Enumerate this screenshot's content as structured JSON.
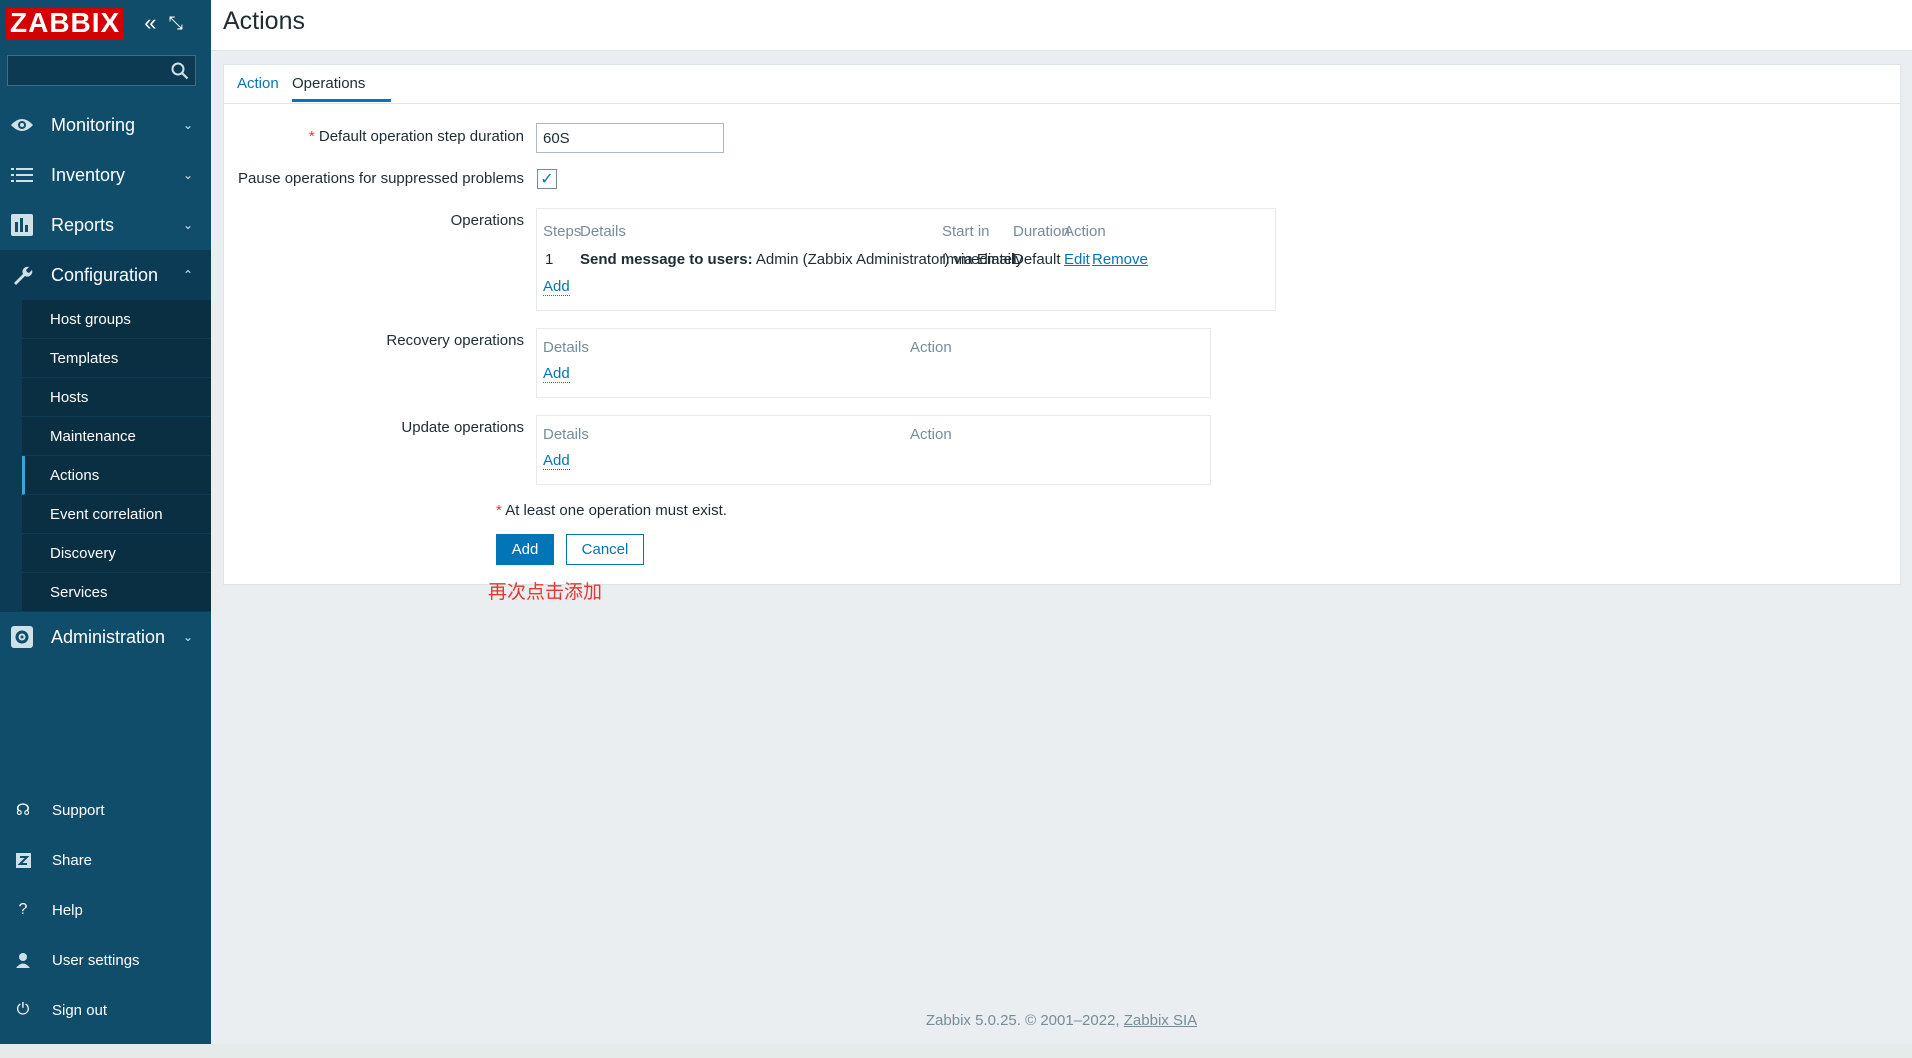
{
  "logo": "ZABBIX",
  "sidebar": {
    "search_placeholder": "",
    "nav": [
      {
        "label": "Monitoring",
        "icon": "eye-icon"
      },
      {
        "label": "Inventory",
        "icon": "list-icon"
      },
      {
        "label": "Reports",
        "icon": "bar-chart-icon"
      },
      {
        "label": "Configuration",
        "icon": "wrench-icon"
      }
    ],
    "config_items": [
      "Host groups",
      "Templates",
      "Hosts",
      "Maintenance",
      "Actions",
      "Event correlation",
      "Discovery",
      "Services"
    ],
    "admin": {
      "label": "Administration",
      "icon": "gear-icon"
    },
    "bottom": [
      {
        "label": "Support",
        "icon": "headset-icon"
      },
      {
        "label": "Share",
        "icon": "z-icon"
      },
      {
        "label": "Help",
        "icon": "question-icon"
      },
      {
        "label": "User settings",
        "icon": "user-icon"
      },
      {
        "label": "Sign out",
        "icon": "power-icon"
      }
    ]
  },
  "header": {
    "title": "Actions"
  },
  "tabs": {
    "action": "Action",
    "operations": "Operations"
  },
  "form": {
    "step_duration_label": "Default operation step duration",
    "step_duration_value": "60S",
    "pause_label": "Pause operations for suppressed problems",
    "pause_checked": true,
    "operations_label": "Operations",
    "ops_headers": {
      "steps": "Steps",
      "details": "Details",
      "start_in": "Start in",
      "duration": "Duration",
      "action": "Action"
    },
    "ops_row": {
      "step": "1",
      "details_bold": "Send message to users:",
      "details_rest": "Admin (Zabbix Administrator) via Email",
      "start_in": "Immediately",
      "duration": "Default",
      "edit": "Edit",
      "remove": "Remove"
    },
    "ops_add": "Add",
    "recovery_label": "Recovery operations",
    "update_label": "Update operations",
    "mini_headers": {
      "details": "Details",
      "action": "Action"
    },
    "mini_add": "Add",
    "note": "At least one operation must exist.",
    "add_button": "Add",
    "cancel_button": "Cancel"
  },
  "annotation": "再次点击添加",
  "footer": {
    "text": "Zabbix 5.0.25. © 2001–2022,",
    "link": "Zabbix SIA"
  }
}
